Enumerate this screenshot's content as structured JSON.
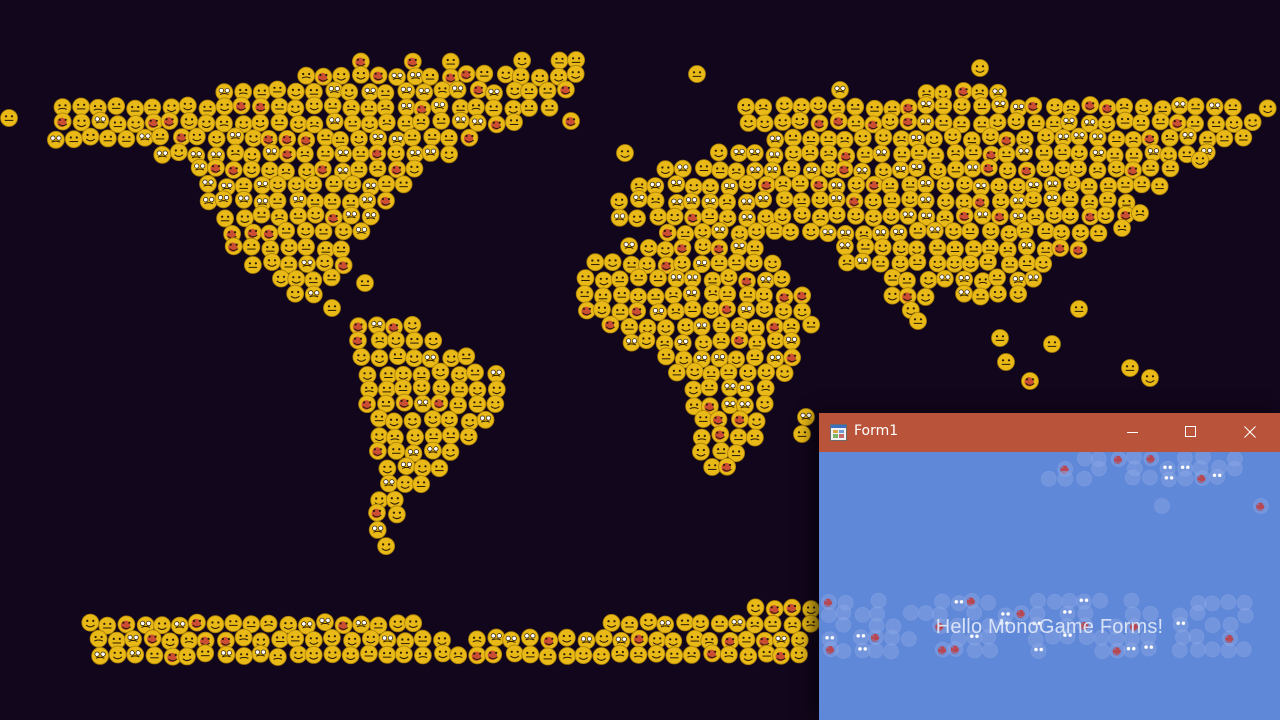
{
  "window": {
    "title": "Form1",
    "icon": "form-app-icon",
    "controls": [
      "minimize-icon",
      "maximize-icon",
      "close-icon"
    ],
    "titlebar_color": "#b9543a",
    "client_color": "#6088d8"
  },
  "client": {
    "message": "Hello MonoGame Forms!"
  },
  "scene": {
    "background_color": "#12061c",
    "sprite": "emoji-face-icon",
    "sprite_color": "#e8b917"
  }
}
